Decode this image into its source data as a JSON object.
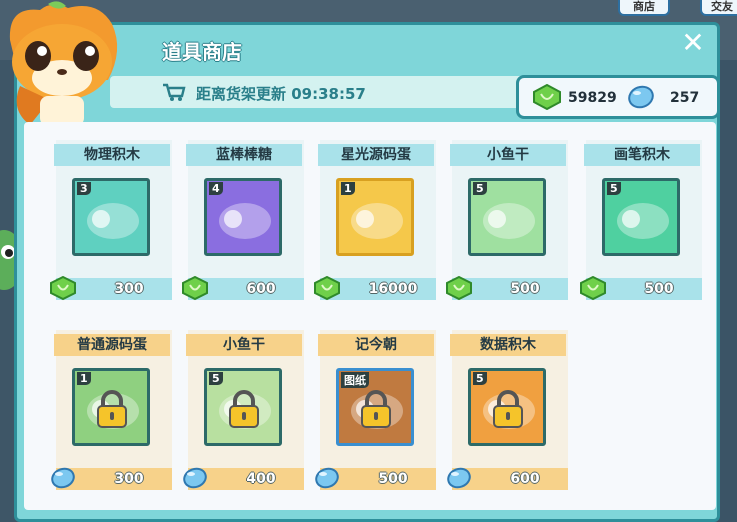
{
  "top_buttons": {
    "shop": "商店",
    "social": "交友"
  },
  "shop": {
    "title": "道具商店",
    "refresh_label": "距离货架更新",
    "refresh_time": "09:38:57"
  },
  "currency": {
    "green_gems": "59829",
    "blue_gems": "257"
  },
  "items": [
    {
      "name": "物理积木",
      "level": "3",
      "price": "300",
      "currency": "green-gem",
      "locked": false,
      "icon": "physics-block-icon",
      "color": "#5fd0c0"
    },
    {
      "name": "蓝棒棒糖",
      "level": "4",
      "price": "600",
      "currency": "green-gem",
      "locked": false,
      "icon": "lollipop-icon",
      "color": "#8a6ee0"
    },
    {
      "name": "星光源码蛋",
      "level": "1",
      "price": "16000",
      "currency": "green-gem",
      "locked": false,
      "icon": "starlight-egg-icon",
      "color": "#f5c84a"
    },
    {
      "name": "小鱼干",
      "level": "5",
      "price": "500",
      "currency": "green-gem",
      "locked": false,
      "icon": "dried-fish-icon",
      "color": "#9fe0a0"
    },
    {
      "name": "画笔积木",
      "level": "5",
      "price": "500",
      "currency": "green-gem",
      "locked": false,
      "icon": "brush-block-icon",
      "color": "#4fd0a0"
    },
    {
      "name": "普通源码蛋",
      "level": "1",
      "price": "300",
      "currency": "blue-gem",
      "locked": true,
      "icon": "normal-egg-icon",
      "color": "#8fd080"
    },
    {
      "name": "小鱼干",
      "level": "5",
      "price": "400",
      "currency": "blue-gem",
      "locked": true,
      "icon": "dried-fish-icon",
      "color": "#b8e0a0"
    },
    {
      "name": "记今朝",
      "level": "图纸",
      "price": "500",
      "currency": "blue-gem",
      "locked": true,
      "icon": "blueprint-icon",
      "color": "#c07a40"
    },
    {
      "name": "数据积木",
      "level": "5",
      "price": "600",
      "currency": "blue-gem",
      "locked": true,
      "icon": "data-block-icon",
      "color": "#f0a040"
    }
  ]
}
